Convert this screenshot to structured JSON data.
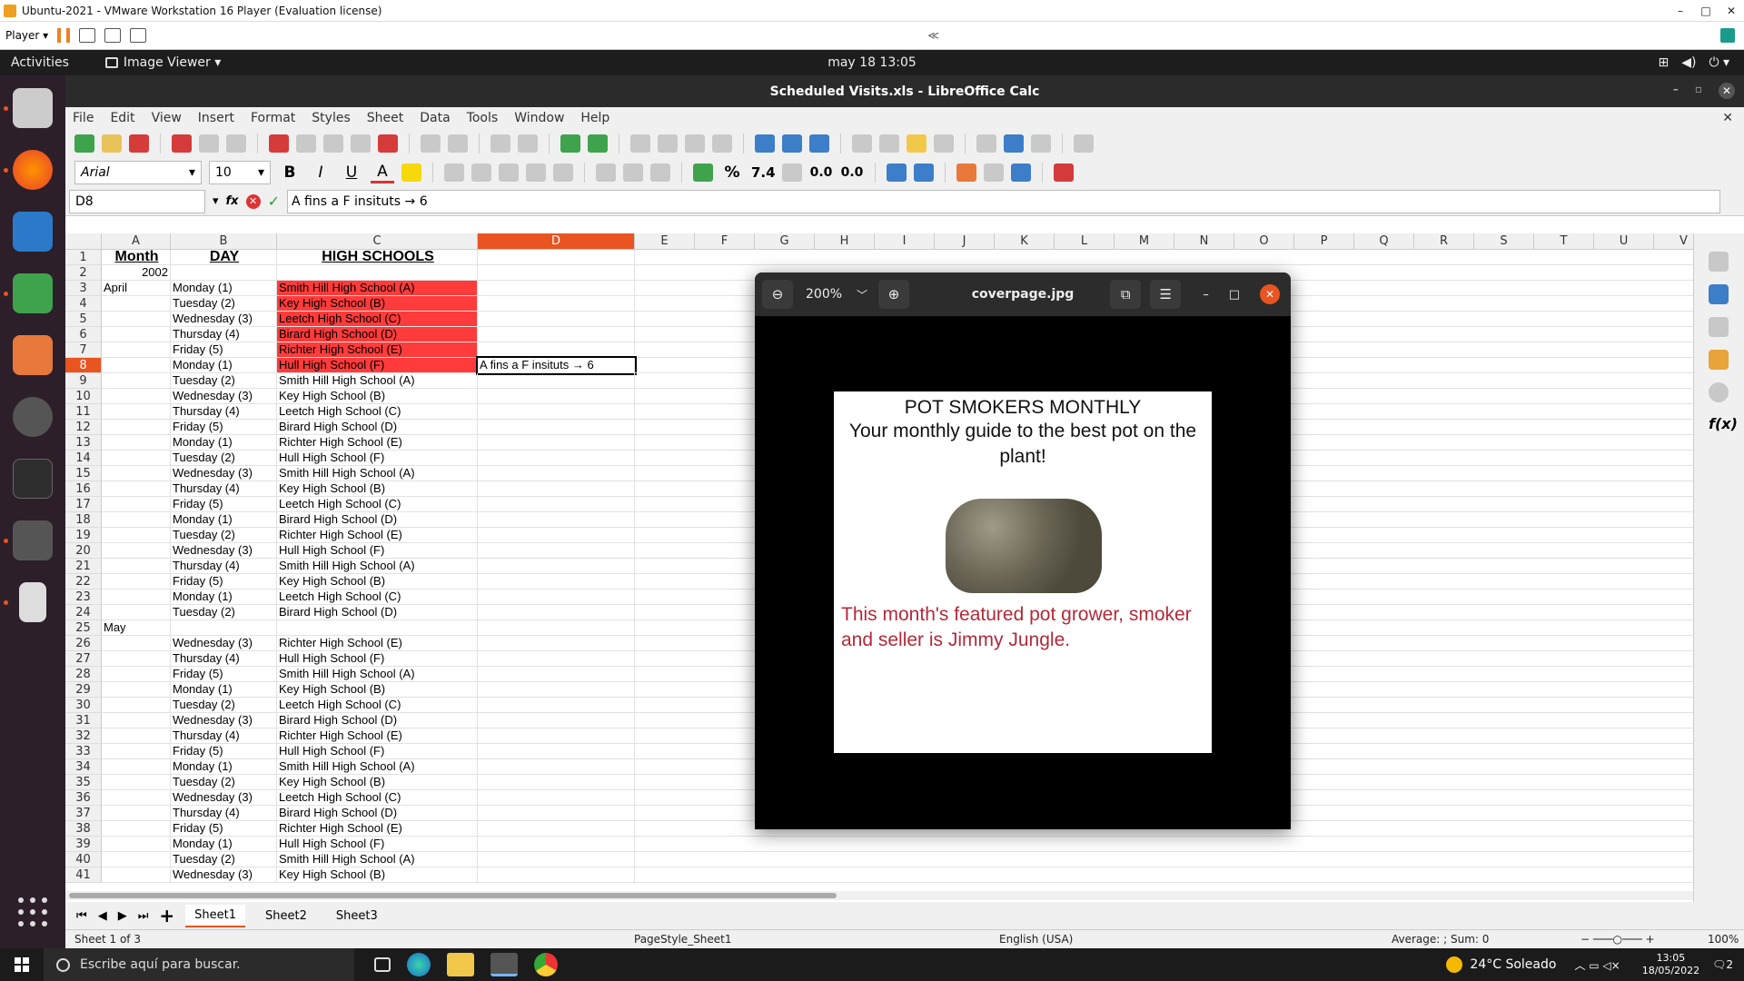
{
  "vm": {
    "title": "Ubuntu-2021 - VMware Workstation 16 Player (Evaluation license)",
    "player_label": "Player",
    "collapse": "≪"
  },
  "gnome": {
    "activities": "Activities",
    "app_menu": "Image Viewer ▾",
    "clock": "may 18  13:05"
  },
  "lo": {
    "title": "Scheduled Visits.xls - LibreOffice Calc",
    "menu": [
      "File",
      "Edit",
      "View",
      "Insert",
      "Format",
      "Styles",
      "Sheet",
      "Data",
      "Tools",
      "Window",
      "Help"
    ],
    "font_name": "Arial",
    "font_size": "10",
    "name_box": "D8",
    "formula": "A fins a F insituts → 6",
    "columns": [
      "A",
      "B",
      "C",
      "D",
      "E",
      "F",
      "G",
      "H",
      "I",
      "J",
      "K",
      "L",
      "M",
      "N",
      "O",
      "P",
      "Q",
      "R",
      "S",
      "T",
      "U",
      "V"
    ],
    "selected_column": "D",
    "selected_row": "8",
    "sheets": [
      "Sheet1",
      "Sheet2",
      "Sheet3"
    ],
    "active_sheet": "Sheet1",
    "status": {
      "sheet_of": "Sheet 1 of 3",
      "page_style": "PageStyle_Sheet1",
      "language": "English (USA)",
      "summary": "Average: ; Sum: 0",
      "zoom": "100%"
    }
  },
  "sheet": {
    "headers": {
      "month": "Month",
      "day": "DAY",
      "schools": "HIGH SCHOOLS"
    },
    "year": "2002",
    "d8": "A fins a F insituts → 6",
    "rows": [
      {
        "n": "3",
        "a": "April",
        "b": "Monday (1)",
        "c": "Smith Hill High School (A)",
        "red": true
      },
      {
        "n": "4",
        "a": "",
        "b": "Tuesday (2)",
        "c": "Key High School (B)",
        "red": true
      },
      {
        "n": "5",
        "a": "",
        "b": "Wednesday (3)",
        "c": "Leetch High School (C)",
        "red": true
      },
      {
        "n": "6",
        "a": "",
        "b": "Thursday (4)",
        "c": "Birard High School (D)",
        "red": true
      },
      {
        "n": "7",
        "a": "",
        "b": "Friday (5)",
        "c": "Richter High School (E)",
        "red": true
      },
      {
        "n": "8",
        "a": "",
        "b": "Monday (1)",
        "c": "Hull High School (F)",
        "red": true
      },
      {
        "n": "9",
        "a": "",
        "b": "Tuesday (2)",
        "c": "Smith Hill High School (A)",
        "red": false
      },
      {
        "n": "10",
        "a": "",
        "b": "Wednesday (3)",
        "c": "Key High School (B)",
        "red": false
      },
      {
        "n": "11",
        "a": "",
        "b": "Thursday (4)",
        "c": "Leetch High School (C)",
        "red": false
      },
      {
        "n": "12",
        "a": "",
        "b": "Friday (5)",
        "c": "Birard High School (D)",
        "red": false
      },
      {
        "n": "13",
        "a": "",
        "b": "Monday (1)",
        "c": "Richter High School (E)",
        "red": false
      },
      {
        "n": "14",
        "a": "",
        "b": "Tuesday (2)",
        "c": "Hull High School (F)",
        "red": false
      },
      {
        "n": "15",
        "a": "",
        "b": "Wednesday (3)",
        "c": "Smith Hill High School (A)",
        "red": false
      },
      {
        "n": "16",
        "a": "",
        "b": "Thursday (4)",
        "c": "Key High School (B)",
        "red": false
      },
      {
        "n": "17",
        "a": "",
        "b": "Friday (5)",
        "c": "Leetch High School (C)",
        "red": false
      },
      {
        "n": "18",
        "a": "",
        "b": "Monday (1)",
        "c": "Birard High School (D)",
        "red": false
      },
      {
        "n": "19",
        "a": "",
        "b": "Tuesday (2)",
        "c": "Richter High School (E)",
        "red": false
      },
      {
        "n": "20",
        "a": "",
        "b": "Wednesday (3)",
        "c": "Hull High School (F)",
        "red": false
      },
      {
        "n": "21",
        "a": "",
        "b": "Thursday (4)",
        "c": "Smith Hill High School (A)",
        "red": false
      },
      {
        "n": "22",
        "a": "",
        "b": "Friday (5)",
        "c": "Key High School (B)",
        "red": false
      },
      {
        "n": "23",
        "a": "",
        "b": "Monday (1)",
        "c": "Leetch High School (C)",
        "red": false
      },
      {
        "n": "24",
        "a": "",
        "b": "Tuesday (2)",
        "c": "Birard High School (D)",
        "red": false
      },
      {
        "n": "25",
        "a": "May",
        "b": "",
        "c": "",
        "red": false
      },
      {
        "n": "26",
        "a": "",
        "b": "Wednesday (3)",
        "c": "Richter High School (E)",
        "red": false
      },
      {
        "n": "27",
        "a": "",
        "b": "Thursday (4)",
        "c": "Hull High School (F)",
        "red": false
      },
      {
        "n": "28",
        "a": "",
        "b": "Friday (5)",
        "c": "Smith Hill High School (A)",
        "red": false
      },
      {
        "n": "29",
        "a": "",
        "b": "Monday (1)",
        "c": "Key High School (B)",
        "red": false
      },
      {
        "n": "30",
        "a": "",
        "b": "Tuesday (2)",
        "c": "Leetch High School (C)",
        "red": false
      },
      {
        "n": "31",
        "a": "",
        "b": "Wednesday (3)",
        "c": "Birard High School (D)",
        "red": false
      },
      {
        "n": "32",
        "a": "",
        "b": "Thursday (4)",
        "c": "Richter High School (E)",
        "red": false
      },
      {
        "n": "33",
        "a": "",
        "b": "Friday (5)",
        "c": "Hull High School (F)",
        "red": false
      },
      {
        "n": "34",
        "a": "",
        "b": "Monday (1)",
        "c": "Smith Hill High School (A)",
        "red": false
      },
      {
        "n": "35",
        "a": "",
        "b": "Tuesday (2)",
        "c": "Key High School (B)",
        "red": false
      },
      {
        "n": "36",
        "a": "",
        "b": "Wednesday (3)",
        "c": "Leetch High School (C)",
        "red": false
      },
      {
        "n": "37",
        "a": "",
        "b": "Thursday (4)",
        "c": "Birard High School (D)",
        "red": false
      },
      {
        "n": "38",
        "a": "",
        "b": "Friday (5)",
        "c": "Richter High School (E)",
        "red": false
      },
      {
        "n": "39",
        "a": "",
        "b": "Monday (1)",
        "c": "Hull High School (F)",
        "red": false
      },
      {
        "n": "40",
        "a": "",
        "b": "Tuesday (2)",
        "c": "Smith Hill High School (A)",
        "red": false
      },
      {
        "n": "41",
        "a": "",
        "b": "Wednesday (3)",
        "c": "Key High School (B)",
        "red": false
      }
    ]
  },
  "viewer": {
    "zoom": "200%",
    "filename": "coverpage.jpg",
    "cover_title": "POT SMOKERS MONTHLY",
    "cover_subtitle": "Your monthly guide to the best pot on the plant!",
    "cover_caption": "This month's featured pot grower, smoker and seller is Jimmy Jungle."
  },
  "taskbar": {
    "search_placeholder": "Escribe aquí para buscar.",
    "weather": "24°C  Soleado",
    "time": "13:05",
    "date": "18/05/2022",
    "notifications": "2"
  },
  "colors": {
    "accent": "#e95420",
    "highlight_red": "#ff3b3b",
    "cover_caption": "#b22a3a"
  }
}
